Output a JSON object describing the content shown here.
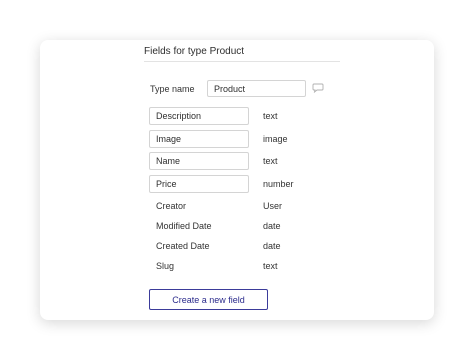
{
  "header": {
    "title": "Fields for type Product"
  },
  "type_name": {
    "label": "Type name",
    "value": "Product"
  },
  "fields": [
    {
      "name": "Description",
      "type": "text",
      "editable": true
    },
    {
      "name": "Image",
      "type": "image",
      "editable": true
    },
    {
      "name": "Name",
      "type": "text",
      "editable": true
    },
    {
      "name": "Price",
      "type": "number",
      "editable": true
    },
    {
      "name": "Creator",
      "type": "User",
      "editable": false
    },
    {
      "name": "Modified Date",
      "type": "date",
      "editable": false
    },
    {
      "name": "Created Date",
      "type": "date",
      "editable": false
    },
    {
      "name": "Slug",
      "type": "text",
      "editable": false
    }
  ],
  "create_button": {
    "label": "Create a new field"
  },
  "icons": {
    "comment": "speech-bubble-icon"
  },
  "colors": {
    "accent": "#2b2b8c",
    "border": "#d4d4d4"
  }
}
